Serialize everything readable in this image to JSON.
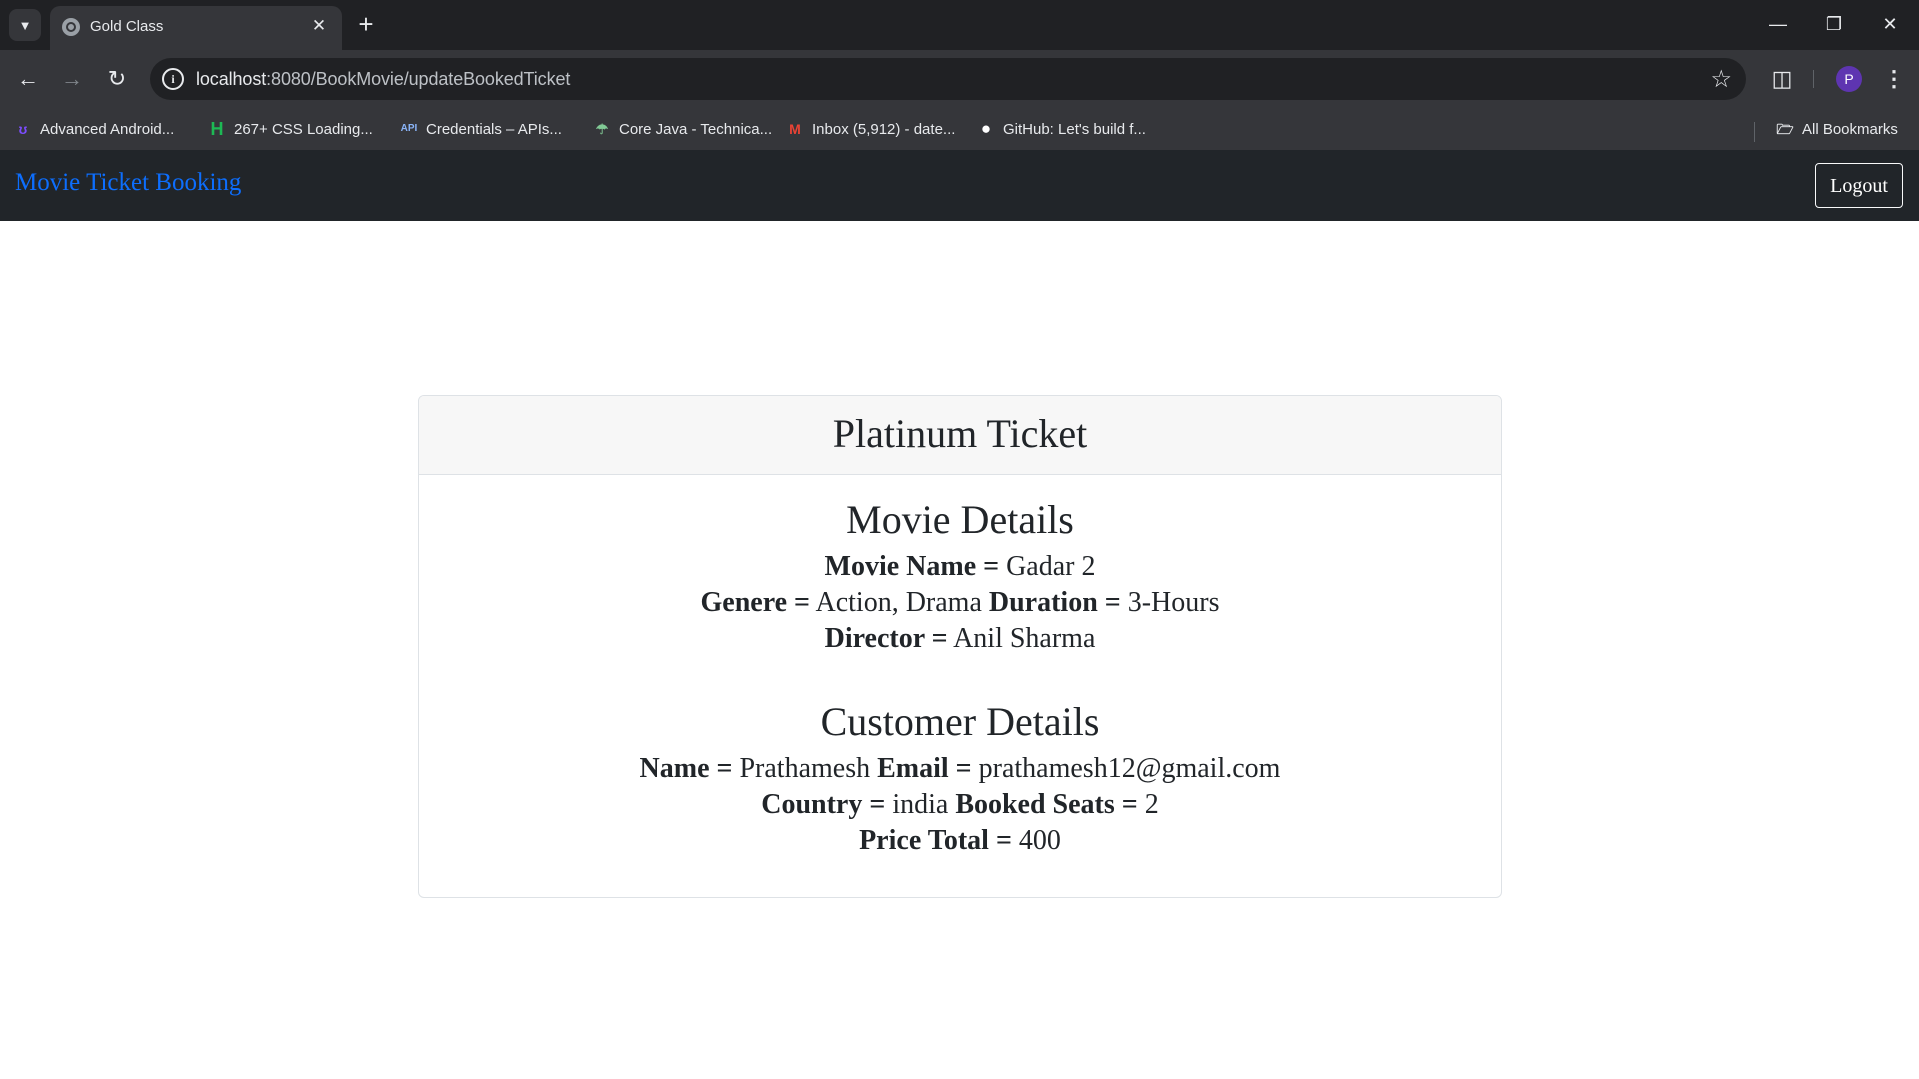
{
  "browser": {
    "tab_title": "Gold Class",
    "url_host": "localhost",
    "url_path": ":8080/BookMovie/updateBookedTicket",
    "profile_initial": "P",
    "bookmarks": [
      {
        "label": "Advanced Android...",
        "icon": "android-dev-icon",
        "color": "#7c4dff",
        "glyph": "ʊ"
      },
      {
        "label": "267+ CSS Loading...",
        "icon": "h-logo-icon",
        "color": "#1db954",
        "glyph": "H"
      },
      {
        "label": "Credentials – APIs...",
        "icon": "api-icon",
        "color": "#8ab4f8",
        "glyph": "API"
      },
      {
        "label": "Core Java - Technica...",
        "icon": "umbrella-icon",
        "color": "#81c995",
        "glyph": "☂"
      },
      {
        "label": "Inbox (5,912) - date...",
        "icon": "gmail-icon",
        "color": "#ea4335",
        "glyph": "M"
      },
      {
        "label": "GitHub: Let's build f...",
        "icon": "github-icon",
        "color": "#ffffff",
        "glyph": "●"
      }
    ],
    "all_bookmarks_label": "All Bookmarks"
  },
  "navbar": {
    "brand": "Movie Ticket Booking",
    "logout_label": "Logout"
  },
  "ticket": {
    "title": "Platinum Ticket",
    "movie_section_title": "Movie Details",
    "movie": {
      "name_label": "Movie Name =",
      "name": "Gadar 2",
      "genre_label": "Genere =",
      "genre": "Action, Drama",
      "duration_label": "Duration =",
      "duration": "3-Hours",
      "director_label": "Director =",
      "director": "Anil Sharma"
    },
    "customer_section_title": "Customer Details",
    "customer": {
      "name_label": "Name =",
      "name": "Prathamesh",
      "email_label": "Email =",
      "email": "prathamesh12@gmail.com",
      "country_label": "Country =",
      "country": "india",
      "seats_label": "Booked Seats =",
      "seats": "2",
      "price_label": "Price Total =",
      "price": "400"
    }
  },
  "colors": {
    "brand_link": "#0d6efd",
    "navbar_bg": "#212529"
  }
}
